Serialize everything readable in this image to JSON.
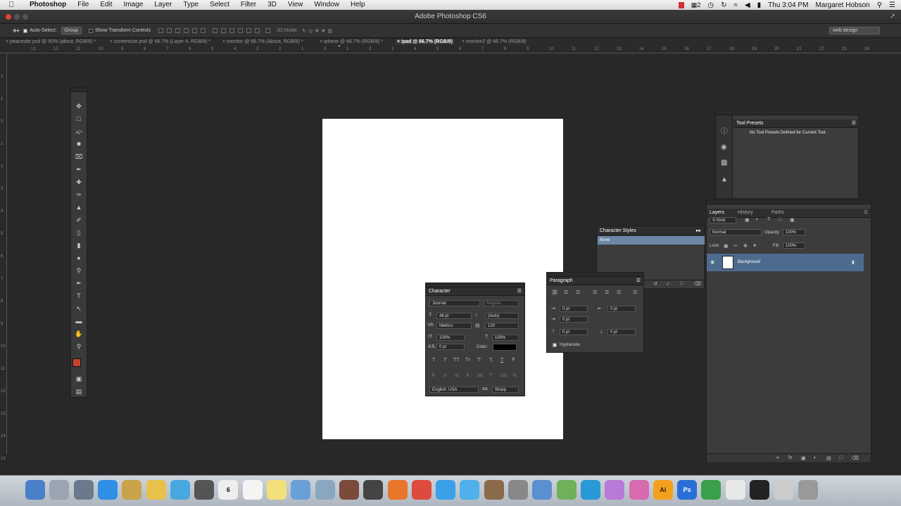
{
  "menubar": {
    "app": "Photoshop",
    "items": [
      "File",
      "Edit",
      "Image",
      "Layer",
      "Type",
      "Select",
      "Filter",
      "3D",
      "View",
      "Window",
      "Help"
    ],
    "badge": "2",
    "clock": "Thu 3:04 PM",
    "user": "Margaret Hobson"
  },
  "window": {
    "title": "Adobe Photoshop CS6"
  },
  "options": {
    "auto_select": "Auto-Select:",
    "group": "Group",
    "transform": "Show Transform Controls",
    "mode3d": "3D Mode:",
    "workspace": "web design"
  },
  "tabs": [
    "peacesite.psd @ 50% (about, RGB/8) *",
    "screensize.psd @ 66.7% (Layer 4, RGB/8) *",
    "monitor @ 66.7% (About, RGB/8) *",
    "iphone @ 66.7% (RGB/8) *",
    "ipad @ 66.7% (RGB/8)",
    "monitor2 @ 66.7% (RGB/8)"
  ],
  "ruler_top": [
    "13",
    "12",
    "11",
    "10",
    "9",
    "8",
    "7",
    "6",
    "5",
    "4",
    "3",
    "2",
    "1",
    "0",
    "1",
    "2",
    "3",
    "4",
    "5",
    "6",
    "7",
    "8",
    "9",
    "10",
    "11",
    "12",
    "13",
    "14",
    "15",
    "16",
    "17",
    "18",
    "19",
    "20",
    "21",
    "22",
    "23",
    "24"
  ],
  "ruler_left": [
    "2",
    "1",
    "0",
    "1",
    "2",
    "3",
    "4",
    "5",
    "6",
    "7",
    "8",
    "9",
    "10",
    "11",
    "12",
    "13",
    "14",
    "15"
  ],
  "character": {
    "title": "Character",
    "font": "Journal",
    "style": "Regular",
    "size": "48 pt",
    "leading": "(Auto)",
    "kerning": "Metrics",
    "tracking": "120",
    "vscale": "100%",
    "hscale": "100%",
    "baseline": "0 pt",
    "color_label": "Color:",
    "language": "English: USA",
    "aa_label": "aa",
    "aa": "Sharp",
    "type_btns": [
      "T",
      "T",
      "TT",
      "Tт",
      "T'",
      "T,",
      "T",
      "Ŧ"
    ],
    "ot_btns": [
      "fi",
      "ơ",
      "st",
      "A",
      "ad",
      "T",
      "1st",
      "½"
    ]
  },
  "paragraph": {
    "title": "Paragraph",
    "indent_left": "0 pt",
    "indent_right": "0 pt",
    "indent_first": "0 pt",
    "space_before": "0 pt",
    "space_after": "0 pt",
    "hyphenate": "Hyphenate"
  },
  "char_styles": {
    "title": "Character Styles",
    "item": "None"
  },
  "tool_presets": {
    "title": "Tool Presets",
    "message": "No Tool Presets Defined for Current Tool."
  },
  "layers": {
    "tabs": [
      "Layers",
      "History",
      "Paths"
    ],
    "kind": "Kind",
    "blend": "Normal",
    "opacity_label": "Opacity:",
    "opacity": "100%",
    "lock_label": "Lock:",
    "fill_label": "Fill:",
    "fill": "100%",
    "layer_name": "Background"
  },
  "dock": {
    "icons": [
      "finder",
      "launchpad",
      "image-capture",
      "app-store",
      "preview",
      "notes",
      "messages",
      "facetime",
      "calendar",
      "reminders",
      "stickies",
      "folder",
      "iphoto",
      "photo-booth",
      "imovie",
      "firefox",
      "chrome",
      "safari",
      "itunes",
      "garageband",
      "system-prefs",
      "dictionary",
      "sync",
      "globe",
      "sketch",
      "pinwheel",
      "illustrator",
      "photoshop",
      "money",
      "documents",
      "terminal",
      "downloads",
      "trash"
    ],
    "calendar_day": "6",
    "ai": "Ai",
    "ps": "Ps"
  },
  "colors": {
    "accent": "#4d6b8f",
    "foreground": "#c9442d",
    "background": "#ffffff"
  }
}
